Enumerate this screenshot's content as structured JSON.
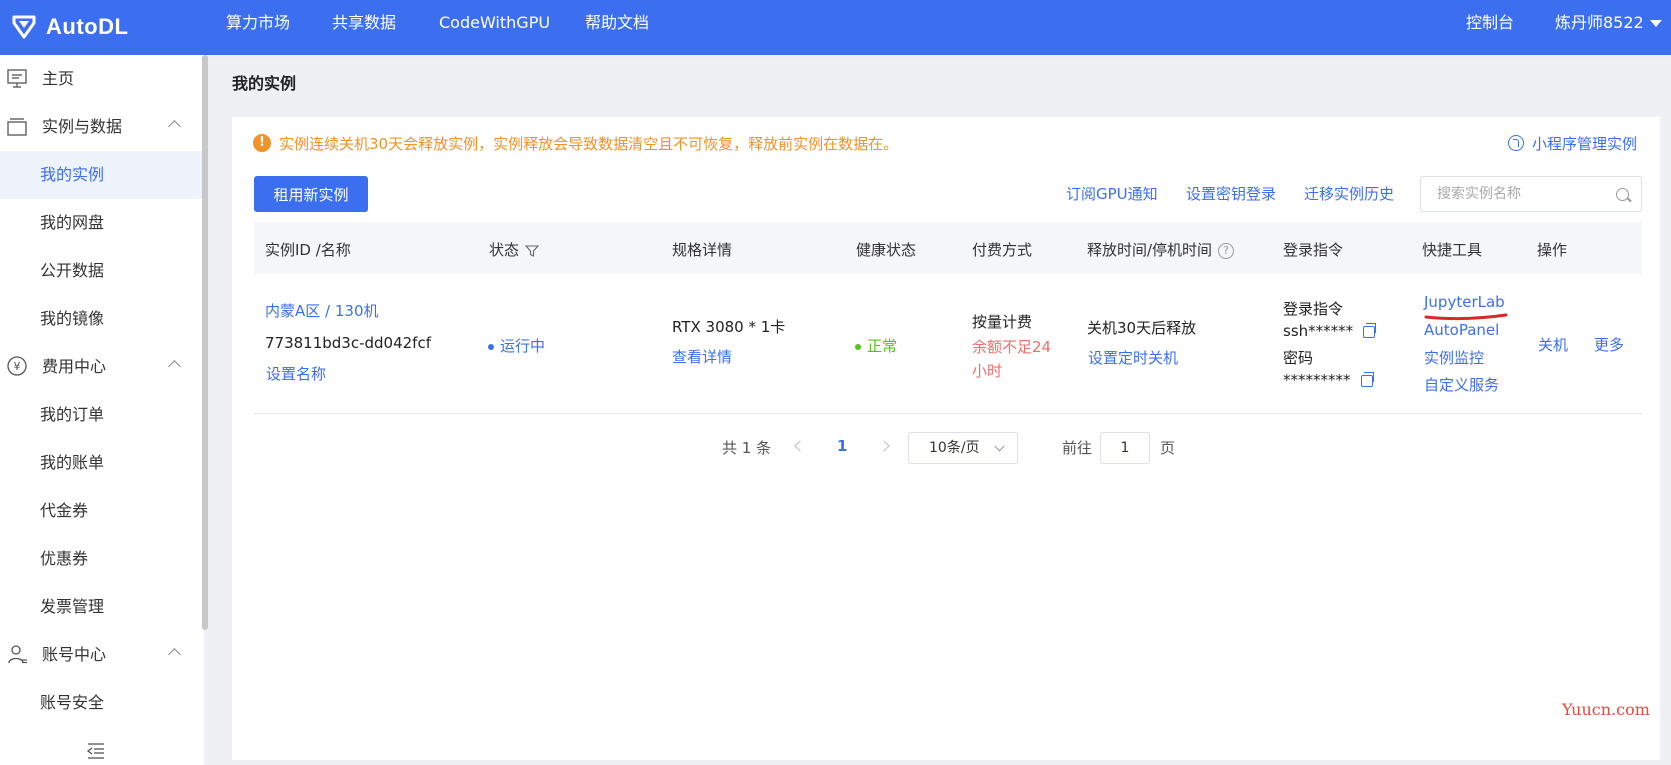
{
  "topbar": {
    "brand": "AutoDL",
    "nav": [
      "算力市场",
      "共享数据",
      "CodeWithGPU",
      "帮助文档"
    ],
    "console": "控制台",
    "user": "炼丹师8522"
  },
  "sidebar": {
    "items": [
      {
        "label": "主页"
      },
      {
        "label": "实例与数据"
      },
      {
        "label": "我的实例"
      },
      {
        "label": "我的网盘"
      },
      {
        "label": "公开数据"
      },
      {
        "label": "我的镜像"
      },
      {
        "label": "费用中心"
      },
      {
        "label": "我的订单"
      },
      {
        "label": "我的账单"
      },
      {
        "label": "代金券"
      },
      {
        "label": "优惠券"
      },
      {
        "label": "发票管理"
      },
      {
        "label": "账号中心"
      },
      {
        "label": "账号安全"
      }
    ]
  },
  "main": {
    "title": "我的实例",
    "notice": "实例连续关机30天会释放实例，实例释放会导致数据清空且不可恢复，释放前实例在数据在。",
    "mini_program": "小程序管理实例",
    "rent_button": "租用新实例",
    "links": [
      "订阅GPU通知",
      "设置密钥登录",
      "迁移实例历史"
    ],
    "search_placeholder": "搜索实例名称"
  },
  "table": {
    "headers": [
      "实例ID /名称",
      "状态",
      "规格详情",
      "健康状态",
      "付费方式",
      "释放时间/停机时间",
      "登录指令",
      "快捷工具",
      "操作"
    ],
    "row": {
      "region": "内蒙A区 / 130机",
      "instance_id": "773811bd3c-dd042fcf",
      "set_name": "设置名称",
      "status": "运行中",
      "spec": "RTX 3080 * 1卡",
      "spec_detail": "查看详情",
      "health": "正常",
      "billing": "按量计费",
      "balance_warn_1": "余额不足24",
      "balance_warn_2": "小时",
      "release": "关机30天后释放",
      "set_shutdown": "设置定时关机",
      "login_label": "登录指令",
      "ssh": "ssh******",
      "password_label": "密码",
      "password": "*********",
      "tools": [
        "JupyterLab",
        "AutoPanel",
        "实例监控",
        "自定义服务"
      ],
      "action_shutdown": "关机",
      "action_more": "更多"
    }
  },
  "pagination": {
    "total": "共 1 条",
    "current": "1",
    "page_size": "10条/页",
    "goto_label": "前往",
    "goto_value": "1",
    "page_suffix": "页"
  },
  "watermark": "Yuucn.com",
  "colors": {
    "primary": "#3c6ff0",
    "warning": "#f0932b",
    "danger": "#f56c6c",
    "success": "#52c41a"
  }
}
